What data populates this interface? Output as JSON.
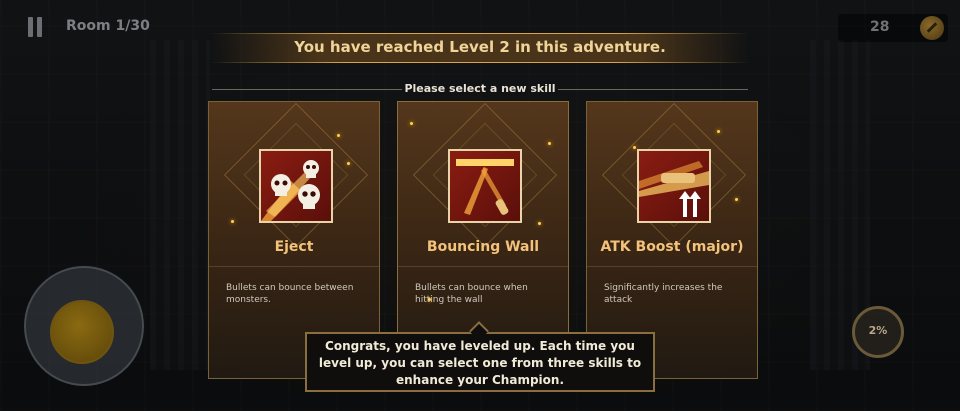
{
  "hud": {
    "room_label": "Room 1/30",
    "coin_count": "28",
    "pause_icon": "pause-icon",
    "coin_icon": "coin-icon"
  },
  "banner": {
    "text": "You have reached Level 2 in this adventure."
  },
  "subtitle": "Please select a new skill",
  "skills": [
    {
      "title": "Eject",
      "description": "Bullets can bounce between monsters.",
      "icon": "skulls-icon"
    },
    {
      "title": "Bouncing Wall",
      "description": "Bullets can bounce when hitting the wall",
      "icon": "bouncing-wall-icon"
    },
    {
      "title": "ATK Boost (major)",
      "description": "Significantly increases the attack",
      "icon": "atk-boost-icon"
    }
  ],
  "tooltip": {
    "text": "Congrats, you have leveled up. Each time you level up, you can select one from three skills to enhance your Champion."
  },
  "skill_button": {
    "label": "2%"
  },
  "colors": {
    "title_gold": "#f3c27b",
    "banner_gold": "#f0d49a",
    "card_border": "#7a6238",
    "icon_red": "#8a1d12"
  }
}
